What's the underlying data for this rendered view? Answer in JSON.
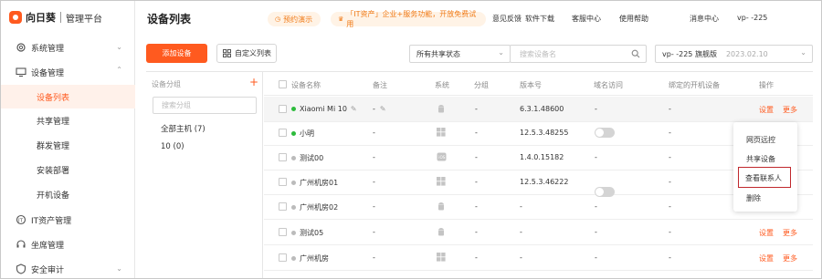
{
  "app": {
    "brand": "向日葵",
    "platform": "管理平台"
  },
  "sidebar": {
    "system": "系统管理",
    "device": "设备管理",
    "sub_items": [
      "设备列表",
      "共享管理",
      "群发管理",
      "安装部署",
      "开机设备"
    ],
    "it_assets": "IT资产管理",
    "seat": "坐席管理",
    "audit": "安全审计"
  },
  "header": {
    "title": "设备列表",
    "promo1": "预约演示",
    "promo2": "「IT资产」企业+服务功能，开放免费试用",
    "links": [
      "意见反馈",
      "软件下载",
      "客服中心",
      "使用帮助",
      "消息中心"
    ],
    "account": "vp-                -225"
  },
  "toolbar": {
    "add_device": "添加设备",
    "custom_list": "自定义列表",
    "share_status": "所有共享状态",
    "search_placeholder": "搜索设备名",
    "plan_name": "vp-            -225 旗舰版",
    "plan_date": "2023.02.10"
  },
  "groups": {
    "header": "设备分组",
    "search_placeholder": "搜索分组",
    "items": [
      "全部主机 (7)",
      "10  (0)"
    ]
  },
  "table": {
    "columns": [
      "设备名称",
      "备注",
      "系统",
      "分组",
      "版本号",
      "域名访问",
      "绑定的开机设备",
      "操作"
    ],
    "rows": [
      {
        "name": "Xiaomi Mi 10",
        "status": "online",
        "remark": "-",
        "os": "android",
        "group": "-",
        "version": "6.3.1.48600",
        "domain": "-",
        "boot": "-",
        "domain_toggle": false
      },
      {
        "name": "小明",
        "status": "online",
        "remark": "-",
        "os": "windows",
        "group": "-",
        "version": "12.5.3.48255",
        "domain": "",
        "boot": "-",
        "domain_toggle": true
      },
      {
        "name": "测试00",
        "status": "offline",
        "remark": "-",
        "os": "ios",
        "group": "-",
        "version": "1.4.0.15182",
        "domain": "-",
        "boot": "-",
        "domain_toggle": false
      },
      {
        "name": "广州机房01",
        "status": "offline",
        "remark": "-",
        "os": "windows",
        "group": "-",
        "version": "12.5.3.46222",
        "domain": "",
        "boot": "-",
        "domain_toggle": true
      },
      {
        "name": "广州机房02",
        "status": "offline",
        "remark": "-",
        "os": "android",
        "group": "-",
        "version": "-",
        "domain": "-",
        "boot": "-",
        "domain_toggle": false
      },
      {
        "name": "测试05",
        "status": "offline",
        "remark": "-",
        "os": "android",
        "group": "-",
        "version": "-",
        "domain": "-",
        "boot": "-",
        "domain_toggle": false
      },
      {
        "name": "广州机房",
        "status": "offline",
        "remark": "-",
        "os": "windows",
        "group": "-",
        "version": "-",
        "domain": "-",
        "boot": "-",
        "domain_toggle": false
      }
    ],
    "actions": {
      "settings": "设置",
      "more": "更多"
    }
  },
  "dropdown": {
    "items": [
      "网页远控",
      "共享设备",
      "查看联系人",
      "删除"
    ]
  },
  "colors": {
    "accent": "#ff5a1f",
    "online": "#2dbb3c",
    "offline": "#bbbbbb",
    "highlight": "#c0282d"
  }
}
